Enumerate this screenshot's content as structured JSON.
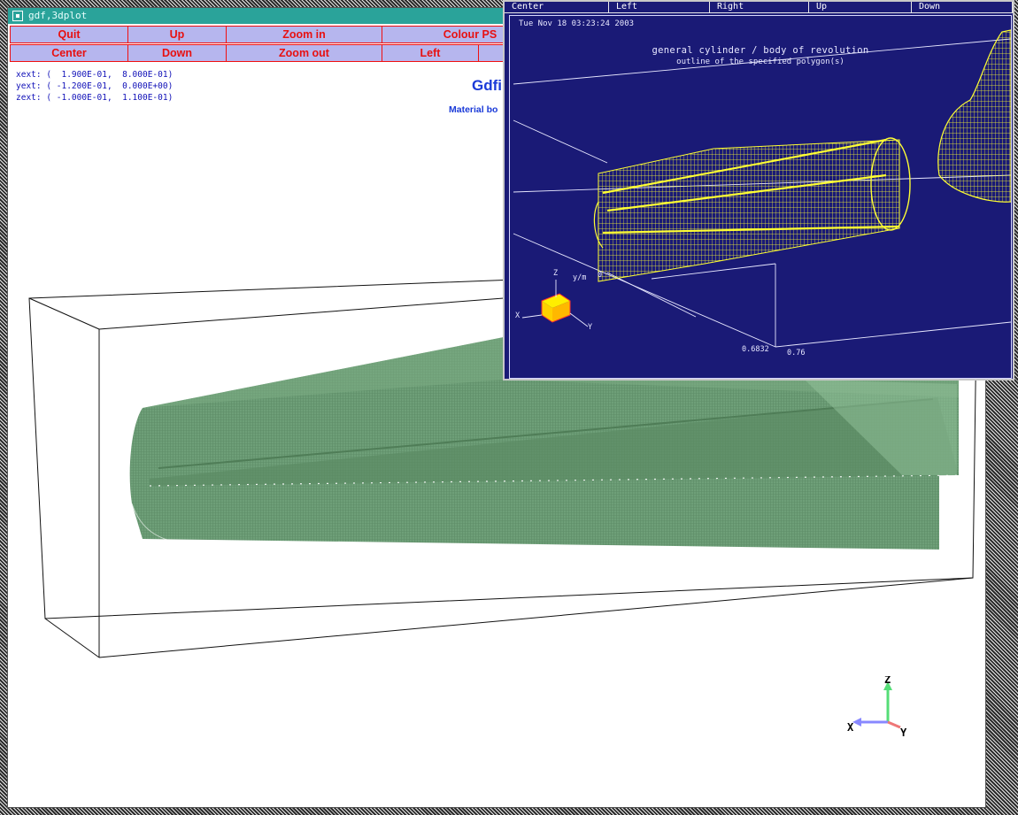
{
  "main_window": {
    "title": "gdf,3dplot",
    "buttons_row1": [
      "Quit",
      "Up",
      "Zoom in",
      "Colour PS"
    ],
    "buttons_row2": [
      "Center",
      "Down",
      "Zoom out",
      "Left"
    ],
    "extents": [
      "xext: (  1.900E-01,  8.000E-01)",
      "yext: ( -1.200E-01,  0.000E+00)",
      "zext: ( -1.000E-01,  1.100E-01)"
    ],
    "plot_title": "Gdfi",
    "plot_subtitle": "Material bo",
    "axis_labels": {
      "z": "Z",
      "x": "X",
      "y": "Y"
    }
  },
  "inset_window": {
    "buttons": [
      "Center",
      "Left",
      "Right",
      "Up",
      "Down"
    ],
    "timestamp": "Tue Nov 18 03:23:24 2003",
    "title": "general cylinder / body of revolution",
    "subtitle": "outline of the specified polygon(s)",
    "axis_unit": "y/m",
    "tick_zero": "0",
    "tick_left": "0.6832",
    "tick_right": "0.76",
    "axis_labels": {
      "z": "Z",
      "x": "X",
      "y": "Y"
    }
  },
  "colors": {
    "mesh_green": "#6e9f78",
    "inset_background": "#1a1a76",
    "wire_yellow": "#ffff33",
    "button_fill": "#b6b6ee",
    "button_text": "#e81010",
    "titlebar": "#2aa39a"
  }
}
